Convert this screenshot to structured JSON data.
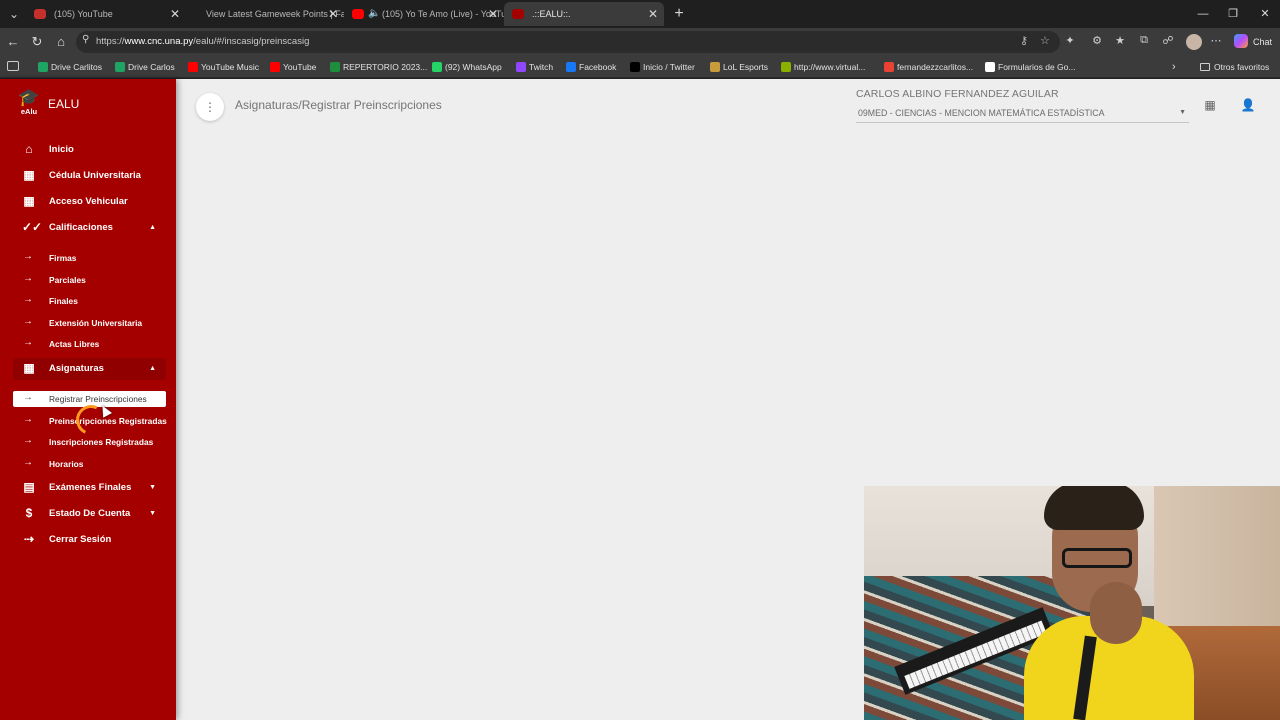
{
  "browser": {
    "tabs": [
      {
        "title": "(105) YouTube",
        "active": false,
        "favicon_color": "#c4302b"
      },
      {
        "title": "View Latest Gameweek Points | Fa",
        "active": false,
        "favicon_color": ""
      },
      {
        "title": "(105) Yo Te Amo (Live) - YouTu",
        "active": false,
        "favicon_color": "#ff0000"
      },
      {
        "title": ".::EALU::.",
        "active": true,
        "favicon_color": "#a50000"
      }
    ],
    "url_prefix": "https://",
    "url_host": "www.cnc.una.py",
    "url_path": "/ealu/#/inscasig/preinscasig",
    "chat_label": "Chat",
    "bookmarks": [
      {
        "label": "Drive Carlitos",
        "color": "#1fa463"
      },
      {
        "label": "Drive Carlos",
        "color": "#1fa463"
      },
      {
        "label": "YouTube Music",
        "color": "#ff0000"
      },
      {
        "label": "YouTube",
        "color": "#ff0000"
      },
      {
        "label": "REPERTORIO 2023...",
        "color": "#1e8e3e"
      },
      {
        "label": "(92) WhatsApp",
        "color": "#25d366"
      },
      {
        "label": "Twitch",
        "color": "#9146ff"
      },
      {
        "label": "Facebook",
        "color": "#1877f2"
      },
      {
        "label": "Inicio / Twitter",
        "color": "#000000"
      },
      {
        "label": "LoL Esports",
        "color": "#c89b3c"
      },
      {
        "label": "http://www.virtual...",
        "color": "#8ab000"
      },
      {
        "label": "fernandezzcarlitos...",
        "color": "#ea4335"
      },
      {
        "label": "Formularios de Go...",
        "color": "#ffffff"
      }
    ],
    "other_bookmarks": "Otros favoritos"
  },
  "app": {
    "brand": "EALU",
    "logo_text": "eAlu",
    "breadcrumb": "Asignaturas/Registrar Preinscripciones",
    "user_name": "CARLOS ALBINO FERNANDEZ AGUILAR",
    "career_selected": "09MED - CIENCIAS - MENCION MATEMÁTICA ESTADÍSTICA",
    "accent_color": "#a50000"
  },
  "sidebar": {
    "inicio": "Inicio",
    "cedula": "Cédula Universitaria",
    "acceso": "Acceso Vehicular",
    "calificaciones": "Calificaciones",
    "calificaciones_items": [
      "Firmas",
      "Parciales",
      "Finales",
      "Extensión Universitaria",
      "Actas Libres"
    ],
    "asignaturas": "Asignaturas",
    "asignaturas_items": [
      "Registrar Preinscripciones",
      "Preinscripciones Registradas",
      "Inscripciones Registradas",
      "Horarios"
    ],
    "examenes": "Exámenes Finales",
    "estado": "Estado De Cuenta",
    "cerrar": "Cerrar Sesión"
  }
}
